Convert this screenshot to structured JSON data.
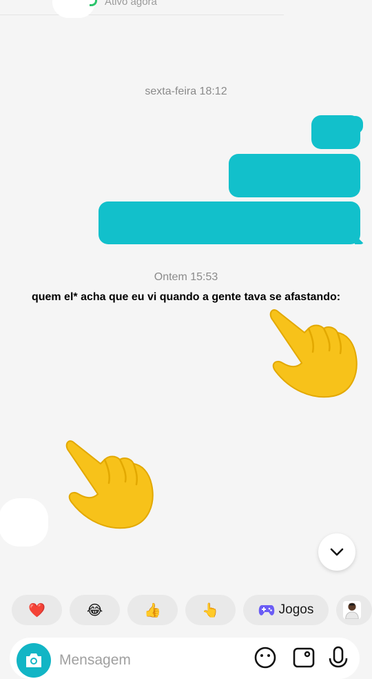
{
  "header": {
    "status": "Ativo agora",
    "status_color": "#2bc46b"
  },
  "conversation": {
    "timestamp_1": "sexta-feira 18:12",
    "timestamp_2": "Ontem 15:53",
    "caption": "quem el* acha que eu vi quando a gente tava se afastando:",
    "bubble_color": "#12c0cb",
    "emoji_content": [
      "pointing-down-hand-emoji",
      "pointing-down-hand-emoji"
    ]
  },
  "quick_reactions": [
    {
      "name": "heart",
      "glyph": "❤️"
    },
    {
      "name": "laughing",
      "glyph": "😂"
    },
    {
      "name": "thumbs-up",
      "glyph": "👍"
    },
    {
      "name": "pointing-hand",
      "glyph": "👆"
    },
    {
      "name": "games",
      "label": "Jogos"
    }
  ],
  "composer": {
    "placeholder": "Mensagem",
    "accent": "#12b5c5"
  },
  "icons": [
    "camera-icon",
    "emoji-icon",
    "image-icon",
    "microphone-icon",
    "chevron-down-icon",
    "gamepad-icon"
  ]
}
